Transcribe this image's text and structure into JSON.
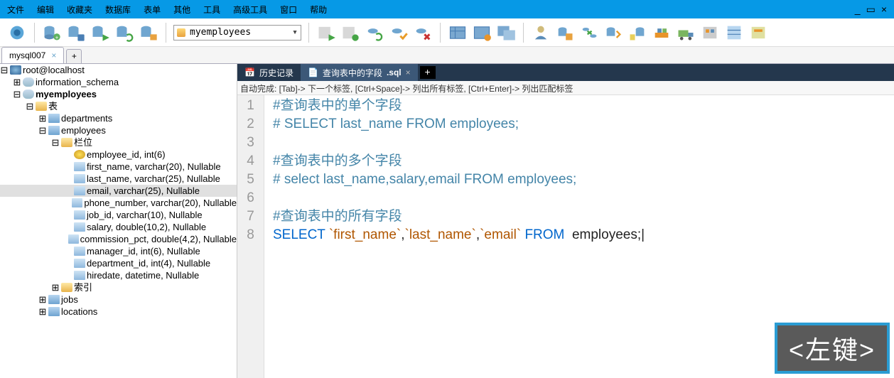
{
  "menubar": {
    "items": [
      "文件",
      "编辑",
      "收藏夹",
      "数据库",
      "表单",
      "其他",
      "工具",
      "高级工具",
      "窗口",
      "帮助"
    ]
  },
  "toolbar": {
    "db_selected": "myemployees"
  },
  "conn_tabs": {
    "items": [
      {
        "label": "mysql007"
      }
    ]
  },
  "tree": {
    "root": "root@localhost",
    "dbs": [
      {
        "name": "information_schema",
        "expanded": false
      },
      {
        "name": "myemployees",
        "expanded": true,
        "bold": true,
        "folders": [
          {
            "name": "表",
            "expanded": true,
            "tables": [
              {
                "name": "departments",
                "expanded": false
              },
              {
                "name": "employees",
                "expanded": true,
                "groups": [
                  {
                    "name": "栏位",
                    "expanded": true,
                    "cols": [
                      {
                        "label": "employee_id, int(6)",
                        "key": true
                      },
                      {
                        "label": "first_name, varchar(20), Nullable"
                      },
                      {
                        "label": "last_name, varchar(25), Nullable"
                      },
                      {
                        "label": "email, varchar(25), Nullable",
                        "selected": true
                      },
                      {
                        "label": "phone_number, varchar(20), Nullable"
                      },
                      {
                        "label": "job_id, varchar(10), Nullable"
                      },
                      {
                        "label": "salary, double(10,2), Nullable"
                      },
                      {
                        "label": "commission_pct, double(4,2), Nullable"
                      },
                      {
                        "label": "manager_id, int(6), Nullable"
                      },
                      {
                        "label": "department_id, int(4), Nullable"
                      },
                      {
                        "label": "hiredate, datetime, Nullable"
                      }
                    ]
                  },
                  {
                    "name": "索引",
                    "expanded": false
                  }
                ]
              },
              {
                "name": "jobs",
                "expanded": false
              },
              {
                "name": "locations",
                "expanded": false
              }
            ]
          }
        ]
      }
    ]
  },
  "file_tabs": {
    "items": [
      {
        "label": "历史记录",
        "active": false
      },
      {
        "label": "查询表中的字段",
        "ext": ".sql",
        "active": true
      }
    ]
  },
  "hint": "自动完成:  [Tab]-> 下一个标签,  [Ctrl+Space]-> 列出所有标签,  [Ctrl+Enter]-> 列出匹配标签",
  "code_lines": [
    {
      "n": 1,
      "seg": [
        {
          "t": "#查询表中的单个字段",
          "c": "comment-h"
        }
      ]
    },
    {
      "n": 2,
      "seg": [
        {
          "t": "# SELECT last_name FROM employees;",
          "c": "comment-h"
        }
      ]
    },
    {
      "n": 3,
      "seg": []
    },
    {
      "n": 4,
      "seg": [
        {
          "t": "#查询表中的多个字段",
          "c": "comment-h"
        }
      ]
    },
    {
      "n": 5,
      "seg": [
        {
          "t": "# select last_name,salary,email FROM employees;",
          "c": "comment-h"
        }
      ]
    },
    {
      "n": 6,
      "seg": []
    },
    {
      "n": 7,
      "seg": [
        {
          "t": "#查询表中的所有字段",
          "c": "comment-h"
        }
      ]
    },
    {
      "n": 8,
      "seg": [
        {
          "t": "SELECT ",
          "c": "kw"
        },
        {
          "t": "`first_name`",
          "c": "str-ident"
        },
        {
          "t": ",",
          "c": "plain"
        },
        {
          "t": "`last_name`",
          "c": "str-ident"
        },
        {
          "t": ",",
          "c": "plain"
        },
        {
          "t": "`email`",
          "c": "str-ident"
        },
        {
          "t": " FROM ",
          "c": "kw"
        },
        {
          "t": " employees;",
          "c": "plain"
        },
        {
          "t": "|",
          "c": "plain"
        }
      ]
    }
  ],
  "overlay_button_label": "<左键>"
}
